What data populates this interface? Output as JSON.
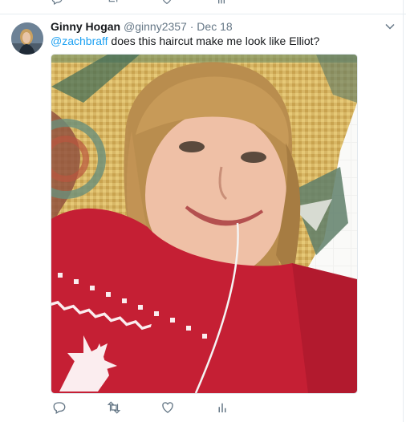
{
  "tweet": {
    "display_name": "Ginny Hogan",
    "handle": "@ginny2357",
    "separator": "·",
    "date": "Dec 18",
    "mention": "@zachbraff",
    "text": " does this haircut make me look like Elliot?"
  },
  "icons": {
    "caret": "chevron-down-icon",
    "reply": "reply-icon",
    "retweet": "retweet-icon",
    "like": "heart-icon",
    "analytics": "analytics-icon"
  },
  "colors": {
    "link": "#1da1f2",
    "secondary_text": "#657786",
    "sweater_red": "#c51f34"
  }
}
